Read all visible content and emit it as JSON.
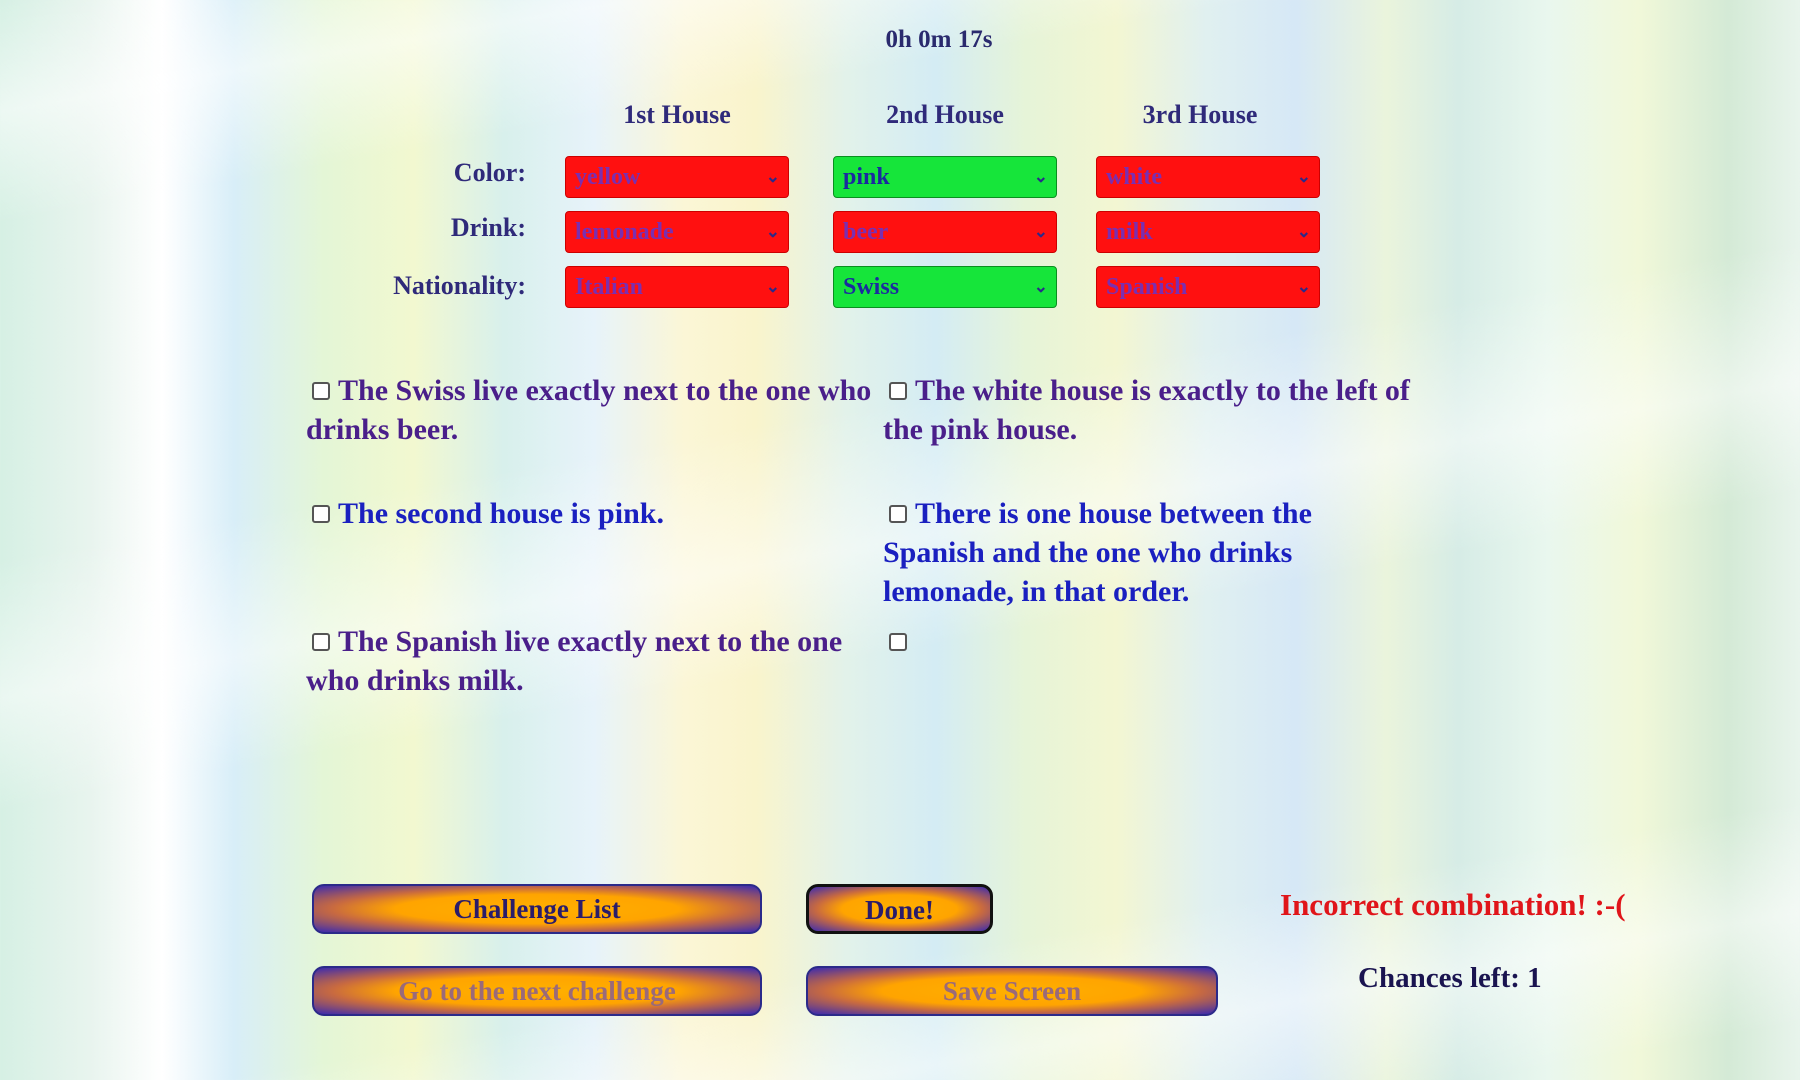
{
  "timer": "0h 0m 17s",
  "columns": [
    "1st House",
    "2nd House",
    "3rd House"
  ],
  "rows": [
    {
      "label": "Color:",
      "cells": [
        {
          "value": "yellow",
          "state": "red"
        },
        {
          "value": "pink",
          "state": "green"
        },
        {
          "value": "white",
          "state": "red"
        }
      ]
    },
    {
      "label": "Drink:",
      "cells": [
        {
          "value": "lemonade",
          "state": "red"
        },
        {
          "value": "beer",
          "state": "red"
        },
        {
          "value": "milk",
          "state": "red"
        }
      ]
    },
    {
      "label": "Nationality:",
      "cells": [
        {
          "value": "Italian",
          "state": "red"
        },
        {
          "value": "Swiss",
          "state": "green"
        },
        {
          "value": "Spanish",
          "state": "red"
        }
      ]
    }
  ],
  "clues": {
    "c1": "The Swiss live exactly next to the one who drinks beer.",
    "c2": "The white house is exactly to the left of the pink house.",
    "c3": "The second house is pink.",
    "c4": "There is one house between the Spanish and the one who drinks lemonade, in that order.",
    "c5": "The Spanish live exactly next to the one who drinks milk.",
    "c6": ""
  },
  "buttons": {
    "challenge_list": "Challenge List",
    "done": "Done!",
    "next_challenge": "Go to the next challenge",
    "save_screen": "Save Screen"
  },
  "status": "Incorrect combination! :-(",
  "chances": "Chances left: 1",
  "colors": {
    "wrong": "#ff1010",
    "correct": "#16e53a",
    "status": "#e0151a"
  }
}
